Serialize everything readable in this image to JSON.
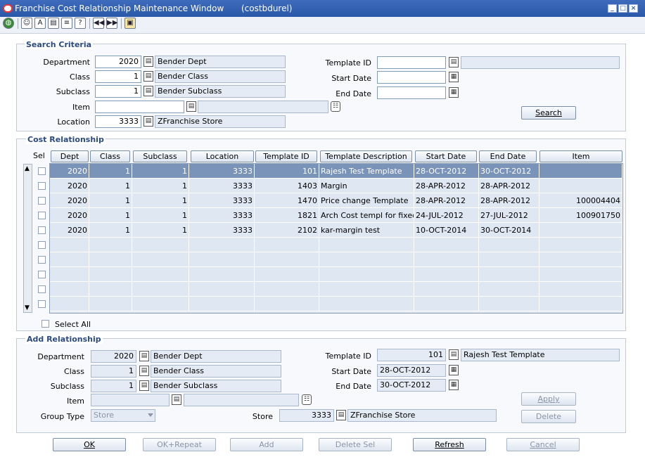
{
  "window": {
    "title": "Franchise Cost Relationship Maintenance Window",
    "module": "(costbdurel)"
  },
  "toolbar": {
    "icons": [
      "globe-icon",
      "action-icon",
      "format-icon",
      "document-icon",
      "print-icon",
      "help-icon",
      "first-record-icon",
      "next-record-icon",
      "window-icon"
    ]
  },
  "search": {
    "title": "Search Criteria",
    "department": {
      "label": "Department",
      "value": "2020",
      "desc": "Bender Dept"
    },
    "class": {
      "label": "Class",
      "value": "1",
      "desc": "Bender Class"
    },
    "subclass": {
      "label": "Subclass",
      "value": "1",
      "desc": "Bender Subclass"
    },
    "item": {
      "label": "Item",
      "value": "",
      "desc": ""
    },
    "location": {
      "label": "Location",
      "value": "3333",
      "desc": "ZFranchise Store"
    },
    "template_id": {
      "label": "Template ID",
      "value": "",
      "desc": ""
    },
    "start_date": {
      "label": "Start Date",
      "value": ""
    },
    "end_date": {
      "label": "End Date",
      "value": ""
    },
    "search_button": "Search"
  },
  "cost": {
    "title": "Cost Relationship",
    "sel_label": "Sel",
    "columns": [
      "Dept",
      "Class",
      "Subclass",
      "Location",
      "Template ID",
      "Template Description",
      "Start Date",
      "End Date",
      "Item"
    ],
    "rows": [
      [
        "2020",
        "1",
        "1",
        "3333",
        "101",
        "Rajesh Test Template",
        "28-OCT-2012",
        "30-OCT-2012",
        ""
      ],
      [
        "2020",
        "1",
        "1",
        "3333",
        "1403",
        "Margin",
        "28-APR-2012",
        "28-APR-2012",
        ""
      ],
      [
        "2020",
        "1",
        "1",
        "3333",
        "1470",
        "Price change Template",
        "28-APR-2012",
        "28-APR-2012",
        "100004404"
      ],
      [
        "2020",
        "1",
        "1",
        "3333",
        "1821",
        "Arch Cost templ for fixed co",
        "24-JUL-2012",
        "27-JUL-2012",
        "100901750"
      ],
      [
        "2020",
        "1",
        "1",
        "3333",
        "2102",
        "kar-margin test",
        "10-OCT-2014",
        "30-OCT-2014",
        ""
      ]
    ],
    "select_all": "Select All"
  },
  "add": {
    "title": "Add Relationship",
    "department": {
      "label": "Department",
      "value": "2020",
      "desc": "Bender Dept"
    },
    "class": {
      "label": "Class",
      "value": "1",
      "desc": "Bender Class"
    },
    "subclass": {
      "label": "Subclass",
      "value": "1",
      "desc": "Bender Subclass"
    },
    "item": {
      "label": "Item",
      "value": "",
      "desc": ""
    },
    "group_type": {
      "label": "Group Type",
      "value": "Store"
    },
    "store": {
      "label": "Store",
      "value": "3333",
      "desc": "ZFranchise Store"
    },
    "template_id": {
      "label": "Template ID",
      "value": "101",
      "desc": "Rajesh Test Template"
    },
    "start_date": {
      "label": "Start Date",
      "value": "28-OCT-2012"
    },
    "end_date": {
      "label": "End Date",
      "value": "30-OCT-2012"
    },
    "apply_button": "Apply",
    "delete_button": "Delete"
  },
  "footer": {
    "ok": "OK",
    "ok_repeat": "OK+Repeat",
    "add": "Add",
    "delete_sel": "Delete Sel",
    "refresh": "Refresh",
    "cancel": "Cancel"
  }
}
